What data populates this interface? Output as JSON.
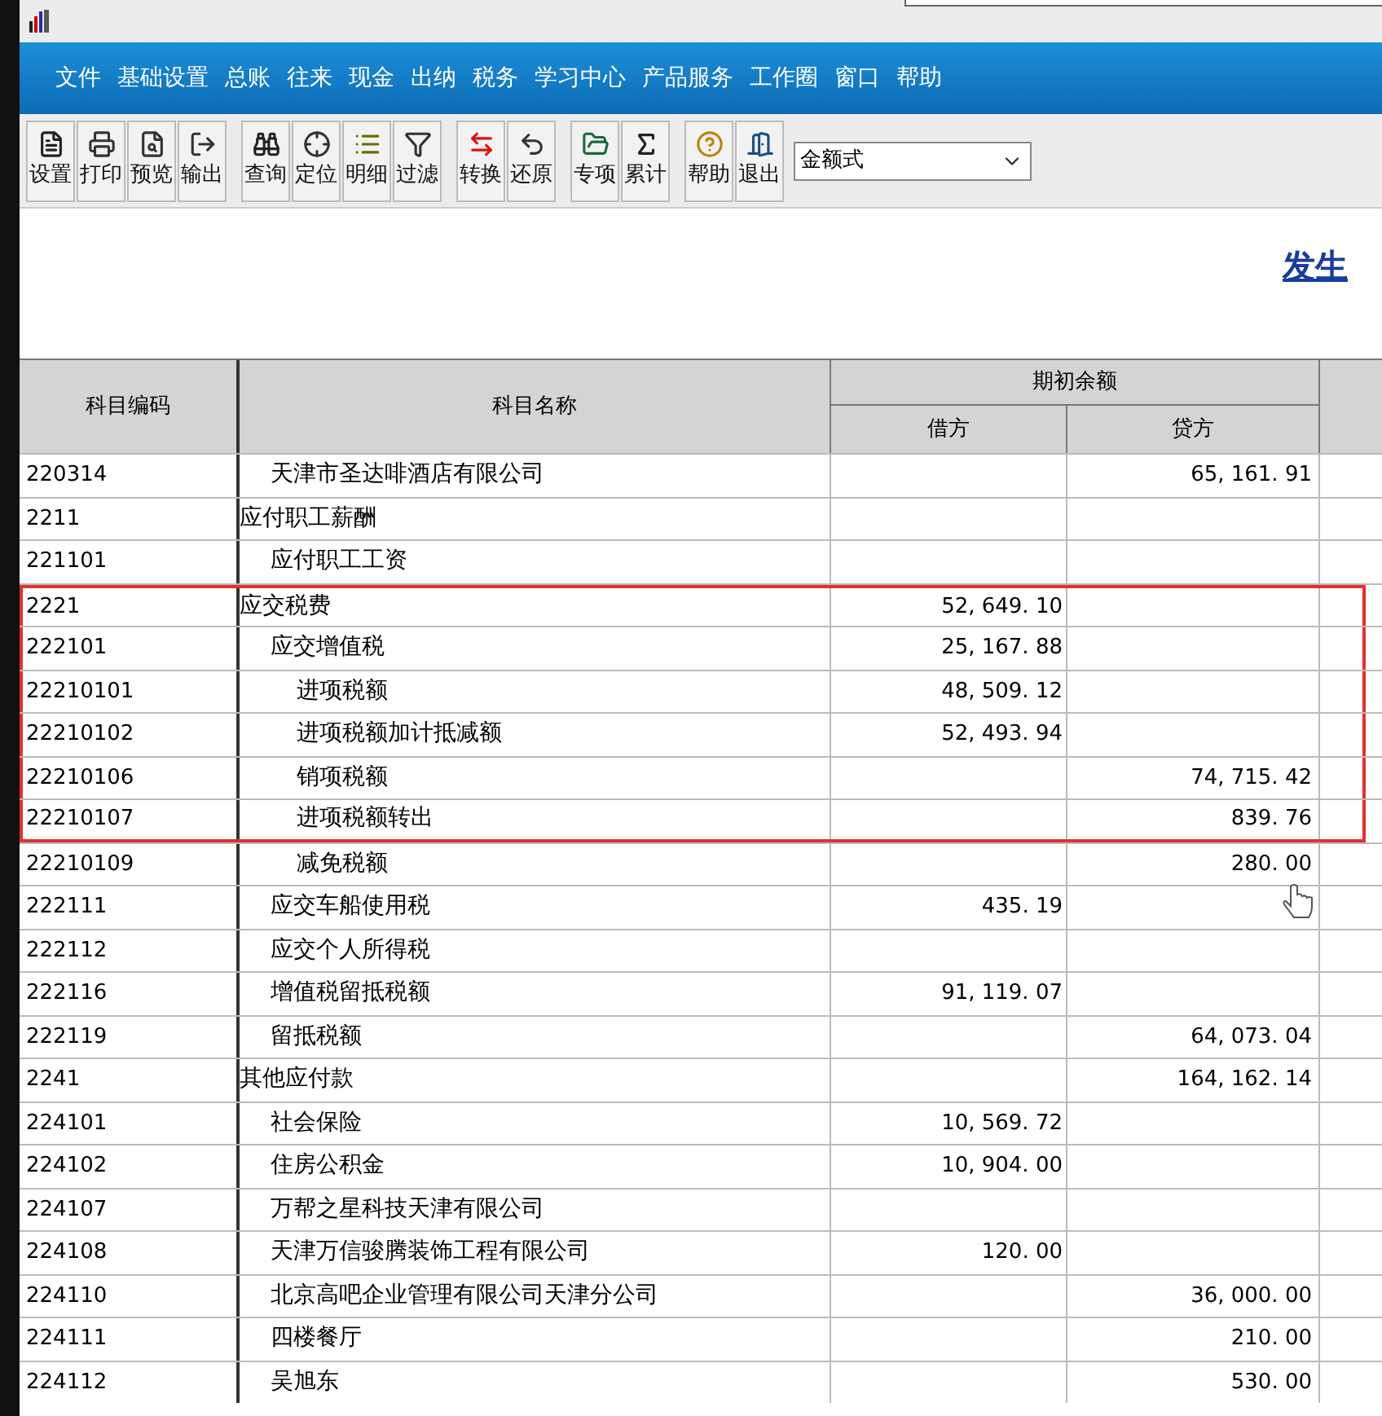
{
  "menu": [
    "文件",
    "基础设置",
    "总账",
    "往来",
    "现金",
    "出纳",
    "税务",
    "学习中心",
    "产品服务",
    "工作圈",
    "窗口",
    "帮助"
  ],
  "toolbar_groups": [
    [
      {
        "label": "设置",
        "kind": "setup"
      },
      {
        "label": "打印",
        "kind": "print"
      },
      {
        "label": "预览",
        "kind": "preview"
      },
      {
        "label": "输出",
        "kind": "export"
      }
    ],
    [
      {
        "label": "查询",
        "kind": "find"
      },
      {
        "label": "定位",
        "kind": "locate"
      },
      {
        "label": "明细",
        "kind": "detail"
      },
      {
        "label": "过滤",
        "kind": "filter"
      }
    ],
    [
      {
        "label": "转换",
        "kind": "convert"
      },
      {
        "label": "还原",
        "kind": "restore"
      }
    ],
    [
      {
        "label": "专项",
        "kind": "special"
      },
      {
        "label": "累计",
        "kind": "sum"
      }
    ],
    [
      {
        "label": "帮助",
        "kind": "help"
      },
      {
        "label": "退出",
        "kind": "exit"
      }
    ]
  ],
  "format_select": {
    "value": "金额式"
  },
  "report_title": "发生",
  "table": {
    "columns": [
      "科目编码",
      "科目名称"
    ],
    "group_header": "期初余额",
    "sub_columns": [
      "借方",
      "贷方"
    ],
    "rows": [
      {
        "children": [
          {
            "code": "220314",
            "name": "天津市圣达啡酒店有限公司",
            "credit": "65, 161. 91",
            "highlighted": false
          }
        ]
      },
      {
        "code": "2211",
        "name": "应付职工薪酬",
        "highlighted": false,
        "children": [
          {
            "code": "221101",
            "name": "应付职工工资",
            "highlighted": false
          }
        ]
      },
      {
        "code": "2221",
        "name": "应交税费",
        "debit": "52, 649. 10",
        "highlighted": true,
        "children": [
          {
            "code": "222101",
            "name": "应交增值税",
            "debit": "25, 167. 88",
            "highlighted": true,
            "children": [
              {
                "code": "22210101",
                "name": "进项税额",
                "debit": "48, 509. 12",
                "highlighted": true
              },
              {
                "code": "22210102",
                "name": "进项税额加计抵减额",
                "debit": "52, 493. 94",
                "highlighted": true
              },
              {
                "code": "22210106",
                "name": "销项税额",
                "credit": "74, 715. 42",
                "highlighted": true
              },
              {
                "code": "22210107",
                "name": "进项税额转出",
                "credit": "839. 76",
                "highlighted": true
              },
              {
                "code": "22210109",
                "name": "减免税额",
                "credit": "280. 00",
                "highlighted": false
              }
            ]
          },
          {
            "code": "222111",
            "name": "应交车船使用税",
            "debit": "435. 19",
            "highlighted": false
          },
          {
            "code": "222112",
            "name": "应交个人所得税",
            "highlighted": false
          },
          {
            "code": "222116",
            "name": "增值税留抵税额",
            "debit": "91, 119. 07",
            "highlighted": false
          },
          {
            "code": "222119",
            "name": "留抵税额",
            "credit": "64, 073. 04",
            "highlighted": false
          }
        ]
      },
      {
        "code": "2241",
        "name": "其他应付款",
        "credit": "164, 162. 14",
        "highlighted": false,
        "children": [
          {
            "code": "224101",
            "name": "社会保险",
            "debit": "10, 569. 72",
            "highlighted": false
          },
          {
            "code": "224102",
            "name": "住房公积金",
            "debit": "10, 904. 00",
            "highlighted": false
          },
          {
            "code": "224107",
            "name": "万帮之星科技天津有限公司",
            "highlighted": false
          },
          {
            "code": "224108",
            "name": "天津万信骏腾装饰工程有限公司",
            "debit": "120. 00",
            "highlighted": false
          },
          {
            "code": "224110",
            "name": "北京高吧企业管理有限公司天津分公司",
            "credit": "36, 000. 00",
            "highlighted": false
          },
          {
            "code": "224111",
            "name": "四楼餐厅",
            "credit": "210. 00",
            "highlighted": false
          },
          {
            "code": "224112",
            "name": "吴旭东",
            "credit": "530. 00",
            "highlighted": false
          }
        ]
      }
    ]
  }
}
